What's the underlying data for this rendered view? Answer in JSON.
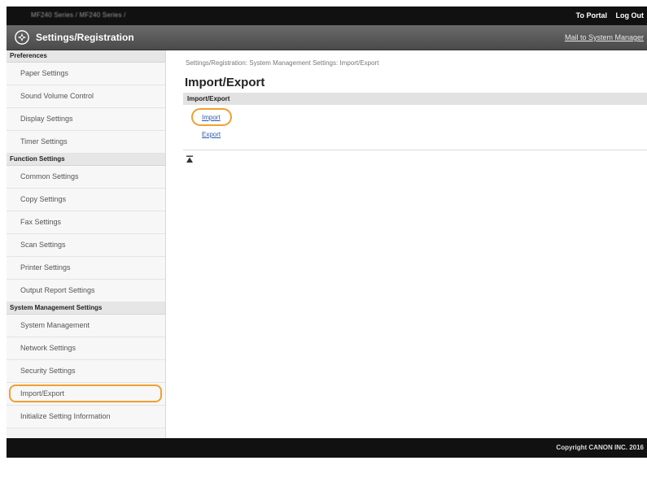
{
  "topbar": {
    "device": "MF240 Series / MF240 Series /",
    "to_portal": "To Portal",
    "log_out": "Log Out"
  },
  "titlebar": {
    "title": "Settings/Registration",
    "mail": "Mail to System Manager"
  },
  "sidebar": {
    "sections": [
      {
        "heading": "Preferences",
        "items": [
          "Paper Settings",
          "Sound Volume Control",
          "Display Settings",
          "Timer Settings"
        ]
      },
      {
        "heading": "Function Settings",
        "items": [
          "Common Settings",
          "Copy Settings",
          "Fax Settings",
          "Scan Settings",
          "Printer Settings",
          "Output Report Settings"
        ]
      },
      {
        "heading": "System Management Settings",
        "items": [
          "System Management",
          "Network Settings",
          "Security Settings",
          "Import/Export",
          "Initialize Setting Information"
        ]
      }
    ],
    "active_item": "Import/Export"
  },
  "main": {
    "breadcrumb": "Settings/Registration: System Management Settings: Import/Export",
    "heading": "Import/Export",
    "panel_heading": "Import/Export",
    "links": {
      "import": "Import",
      "export": "Export"
    }
  },
  "footer": {
    "copyright": "Copyright CANON INC. 2016"
  },
  "colors": {
    "highlight": "#f0a030",
    "link": "#2a5db0",
    "bar": "#111111"
  }
}
